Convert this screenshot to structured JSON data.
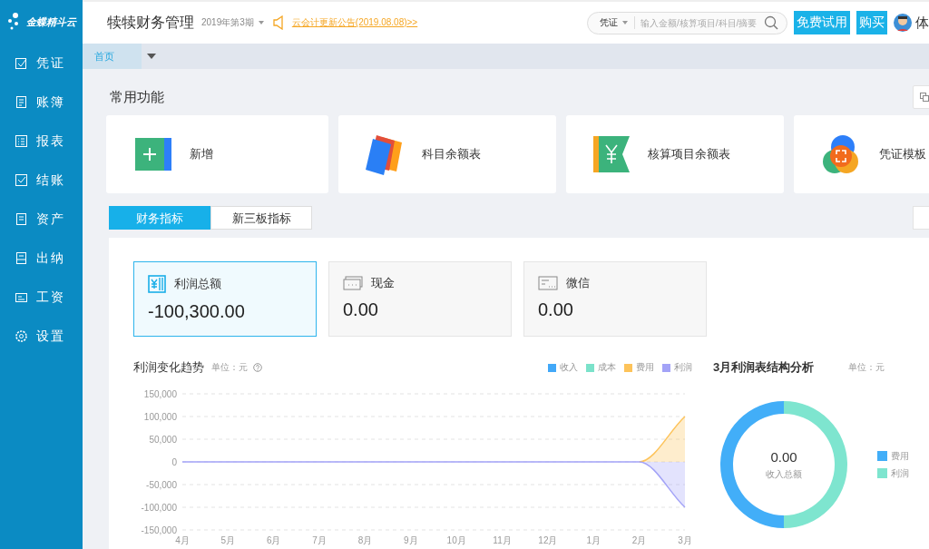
{
  "logo": {
    "text": "金蝶精斗云"
  },
  "sidebar": {
    "items": [
      {
        "label": "凭证",
        "selected": false
      },
      {
        "label": "账簿",
        "selected": false
      },
      {
        "label": "报表",
        "selected": false
      },
      {
        "label": "结账",
        "selected": false
      },
      {
        "label": "资产",
        "selected": false
      },
      {
        "label": "出纳",
        "selected": false
      },
      {
        "label": "工资",
        "selected": false
      },
      {
        "label": "设置",
        "selected": false
      }
    ]
  },
  "header": {
    "title": "犊犊财务管理",
    "period": "2019年第3期",
    "notice": "云会计更新公告(2019.08.08)>>",
    "search": {
      "scope": "凭证",
      "placeholder": "输入金额/核算项目/科目/摘要"
    },
    "buttons": [
      "免费试用",
      "购买"
    ],
    "user": "体"
  },
  "tabs": [
    {
      "label": "首页",
      "selected": true
    }
  ],
  "quick": {
    "title": "常用功能",
    "items": [
      {
        "label": "新增"
      },
      {
        "label": "科目余额表"
      },
      {
        "label": "核算项目余额表"
      },
      {
        "label": "凭证模板"
      }
    ]
  },
  "indicator_tabs": [
    {
      "label": "财务指标",
      "selected": true
    },
    {
      "label": "新三板指标",
      "selected": false
    }
  ],
  "metrics": [
    {
      "label": "利润总额",
      "value": "-100,300.00",
      "selected": true
    },
    {
      "label": "现金",
      "value": "0.00",
      "selected": false
    },
    {
      "label": "微信",
      "value": "0.00",
      "selected": false
    }
  ],
  "trend": {
    "title": "利润变化趋势",
    "unit": "单位：元",
    "chart_data": {
      "type": "area",
      "grid": true,
      "categories": [
        "4月",
        "5月",
        "6月",
        "7月",
        "8月",
        "9月",
        "10月",
        "11月",
        "12月",
        "1月",
        "2月",
        "3月"
      ],
      "ylim": [
        -150000,
        150000
      ],
      "yticks": [
        {
          "value": 150000,
          "label": "150,000"
        },
        {
          "value": 100000,
          "label": "100,000"
        },
        {
          "value": 50000,
          "label": "50,000"
        },
        {
          "value": 0,
          "label": "0"
        },
        {
          "value": -50000,
          "label": "-50,000"
        },
        {
          "value": -100000,
          "label": "-100,000"
        },
        {
          "value": -150000,
          "label": "-150,000"
        }
      ],
      "series": [
        {
          "name": "收入",
          "color": "#42a8f8",
          "values": [
            null,
            null,
            null,
            null,
            null,
            null,
            null,
            null,
            null,
            null,
            null,
            null
          ]
        },
        {
          "name": "成本",
          "color": "#7be2ca",
          "values": [
            null,
            null,
            null,
            null,
            null,
            null,
            null,
            null,
            null,
            null,
            null,
            null
          ]
        },
        {
          "name": "费用",
          "color": "#fdc35a",
          "values": [
            null,
            null,
            null,
            null,
            null,
            null,
            null,
            null,
            null,
            null,
            0,
            100000
          ]
        },
        {
          "name": "利润",
          "color": "#a3a3f7",
          "values": [
            0,
            0,
            0,
            0,
            0,
            0,
            0,
            0,
            0,
            0,
            0,
            -100000
          ]
        }
      ]
    }
  },
  "structure": {
    "title": "3月利润表结构分析",
    "unit": "单位：元",
    "center_value": "0.00",
    "center_label": "收入总额",
    "legend": [
      {
        "label": "费用",
        "color": "#42aef8"
      },
      {
        "label": "利润",
        "color": "#7ee5cf"
      }
    ]
  }
}
